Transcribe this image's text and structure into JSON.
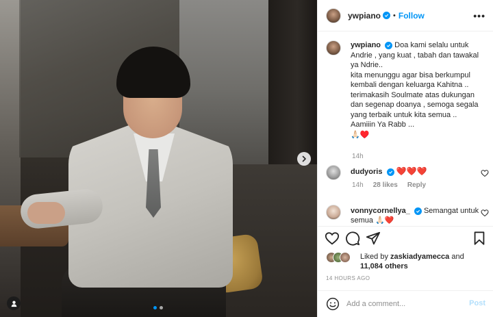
{
  "post": {
    "username": "ywpiano",
    "follow_label": "Follow",
    "separator": "•",
    "more_label": "•••",
    "carousel": {
      "total_slides": 2,
      "active_slide": 1
    }
  },
  "caption": {
    "username": "ywpiano",
    "lines": [
      "Doa kami selalu untuk",
      "Andrie , yang kuat , tabah dan tawakal ya Ndrie..",
      "kita menunggu agar bisa berkumpul kembali dengan keluarga Kahitna ..",
      "terimakasih Soulmate atas dukungan dan segenap doanya , semoga segala yang terbaik untuk kita semua ..",
      "Aamiiin Ya Rabb ..."
    ],
    "emoji": "🙏🏻♥️",
    "time": "14h"
  },
  "comments": [
    {
      "username": "dudyoris",
      "text": "❤️❤️❤️",
      "time": "14h",
      "likes": "28 likes",
      "reply_label": "Reply"
    },
    {
      "username": "vonnycornellya_",
      "text": "Semangat untuk semua 🙏🏻❤️"
    }
  ],
  "likes": {
    "liked_by_prefix": "Liked by",
    "liked_by_user": "zaskiadyamecca",
    "and_label": "and",
    "others": "11,084 others"
  },
  "timestamp": "14 HOURS AGO",
  "add_comment": {
    "placeholder": "Add a comment...",
    "post_label": "Post"
  },
  "icons": {
    "verified": "verified-badge-icon",
    "like": "heart-icon",
    "comment": "comment-icon",
    "share": "share-icon",
    "save": "bookmark-icon",
    "emoji": "smiley-icon",
    "next": "chevron-right-icon",
    "tag": "user-tag-icon"
  },
  "colors": {
    "accent": "#0095f6",
    "muted": "#8e8e8e",
    "text": "#262626",
    "post_disabled": "#b2dffc",
    "heart_red": "#ed1c24"
  }
}
